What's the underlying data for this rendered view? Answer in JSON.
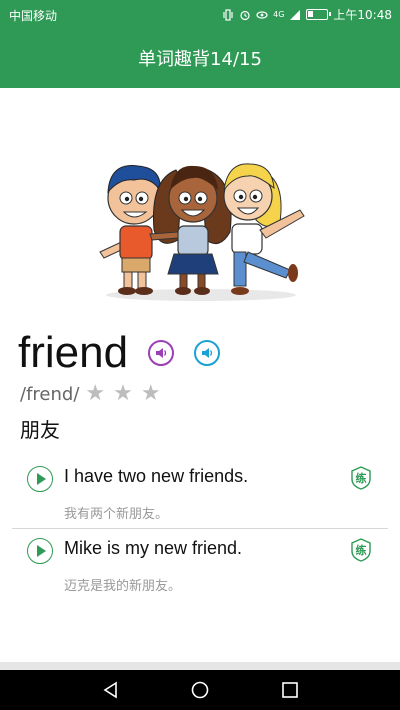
{
  "status": {
    "carrier": "中国移动",
    "signal_label": "4G",
    "time": "上午10:48"
  },
  "header": {
    "title": "单词趣背14/15"
  },
  "word": {
    "text": "friend",
    "phonetic": "/frend/",
    "meaning": "朋友",
    "rating": 3,
    "rating_max": 3
  },
  "examples": [
    {
      "en": "I have two new friends.",
      "zh": "我有两个新朋友。",
      "practice_label": "练"
    },
    {
      "en": "Mike is my new friend.",
      "zh": "迈克是我的新朋友。",
      "practice_label": "练"
    }
  ],
  "colors": {
    "brand": "#2e9a55",
    "uk_speaker": "#9a3fb5",
    "us_speaker": "#1aa1d6",
    "star": "#bdbdbd"
  },
  "icons": [
    "vibrate-icon",
    "alarm-icon",
    "eye-icon",
    "signal-icon",
    "battery-icon",
    "speaker-icon",
    "play-icon",
    "practice-icon",
    "back-icon",
    "home-icon",
    "recents-icon",
    "star-icon"
  ]
}
